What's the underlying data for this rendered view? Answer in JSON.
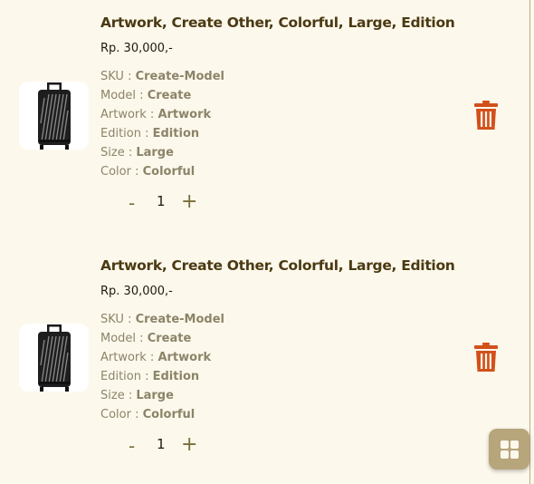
{
  "cart": {
    "items": [
      {
        "title": "Artwork, Create Other, Colorful, Large, Edition",
        "price": "Rp. 30,000,-",
        "attributes": [
          {
            "label": "SKU : ",
            "value": "Create-Model"
          },
          {
            "label": "Model : ",
            "value": "Create"
          },
          {
            "label": "Artwork : ",
            "value": "Artwork"
          },
          {
            "label": "Edition : ",
            "value": "Edition"
          },
          {
            "label": "Size : ",
            "value": "Large"
          },
          {
            "label": "Color : ",
            "value": "Colorful"
          }
        ],
        "quantity": "1",
        "minus_label": "-",
        "plus_label": "+",
        "image_icon": "suitcase-icon",
        "delete_icon": "trash-icon"
      },
      {
        "title": "Artwork, Create Other, Colorful, Large, Edition",
        "price": "Rp. 30,000,-",
        "attributes": [
          {
            "label": "SKU : ",
            "value": "Create-Model"
          },
          {
            "label": "Model : ",
            "value": "Create"
          },
          {
            "label": "Artwork : ",
            "value": "Artwork"
          },
          {
            "label": "Edition : ",
            "value": "Edition"
          },
          {
            "label": "Size : ",
            "value": "Large"
          },
          {
            "label": "Color : ",
            "value": "Colorful"
          }
        ],
        "quantity": "1",
        "minus_label": "-",
        "plus_label": "+",
        "image_icon": "suitcase-icon",
        "delete_icon": "trash-icon"
      }
    ]
  },
  "fab": {
    "icon": "grid-icon"
  },
  "colors": {
    "background": "#fdf8ec",
    "title": "#4a3a12",
    "attribute": "#8b8468",
    "delete": "#d2511b",
    "fab": "#b7a57c"
  }
}
